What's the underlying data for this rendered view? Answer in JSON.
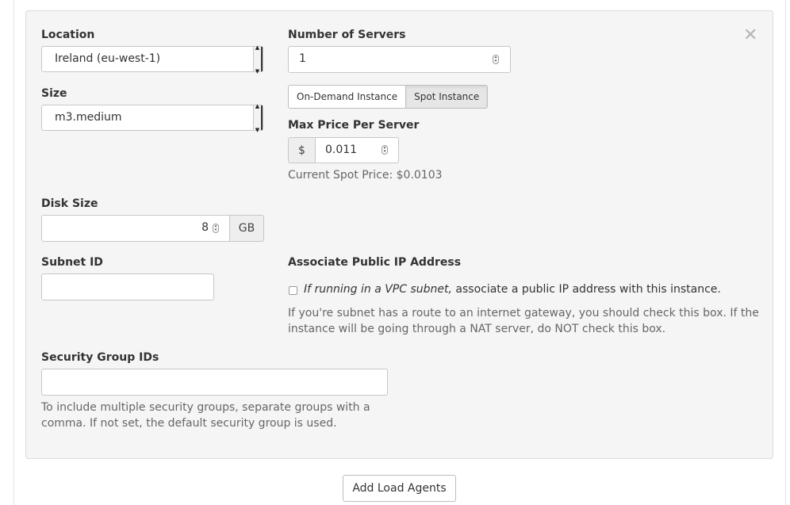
{
  "form": {
    "location": {
      "label": "Location",
      "selected": "Ireland (eu-west-1)"
    },
    "size": {
      "label": "Size",
      "selected": "m3.medium"
    },
    "servers": {
      "label": "Number of Servers",
      "value": "1"
    },
    "instance_type": {
      "on_demand_label": "On-Demand Instance",
      "spot_label": "Spot Instance",
      "active": "Spot Instance"
    },
    "max_price": {
      "label": "Max Price Per Server",
      "currency_symbol": "$",
      "value": "0.011",
      "spot_note": "Current Spot Price: $0.0103"
    },
    "disk": {
      "label": "Disk Size",
      "value": "8",
      "unit": "GB"
    },
    "subnet": {
      "label": "Subnet ID",
      "value": ""
    },
    "public_ip": {
      "label": "Associate Public IP Address",
      "checkbox_emphasis": "If running in a VPC subnet,",
      "checkbox_rest": " associate a public IP address with this instance.",
      "checked": false,
      "help_line1": "If you're subnet has a route to an internet gateway, you should check this box. If the",
      "help_line2": "instance will be going through a NAT server, do NOT check this box."
    },
    "security_groups": {
      "label": "Security Group IDs",
      "value": "",
      "help_line1": "To include multiple security groups, separate groups with a",
      "help_line2": "comma. If not set, the default security group is used."
    }
  },
  "icons": {
    "close": "close-icon",
    "select_arrow": "chevron-updown-icon",
    "spinner": "spinner-icon"
  },
  "actions": {
    "add_label": "Add Load Agents"
  }
}
